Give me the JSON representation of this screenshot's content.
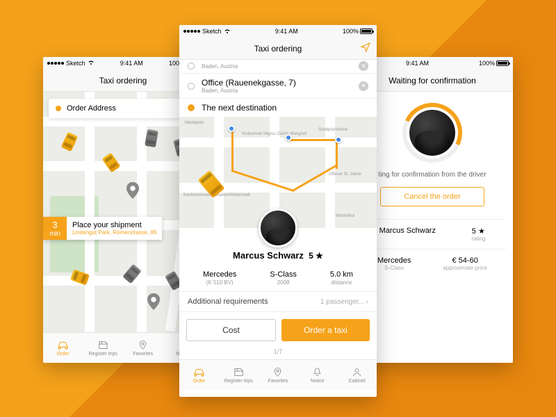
{
  "status": {
    "carrier": "Sketch",
    "time": "9:41 AM",
    "battery": "100%"
  },
  "left": {
    "title": "Taxi ordering",
    "address_label": "Order Address",
    "ship": {
      "min_n": "3",
      "min_u": "min",
      "title": "Place your shipment",
      "addr": "Lindengut Park, Römerstrasse, 86"
    },
    "tabs": [
      "Order",
      "Register trips",
      "Favorites",
      "Notice"
    ]
  },
  "center": {
    "title": "Taxi ordering",
    "addr1": {
      "title": "",
      "sub": "Baden, Austria"
    },
    "addr2": {
      "title": "Office (Rauenekgasse, 7)",
      "sub": "Baden, Austria"
    },
    "next": "The next destination",
    "driver": {
      "name": "Marcus Schwarz",
      "rating": "5"
    },
    "details": {
      "car": "Mercedes",
      "plate": "(K 510 BV)",
      "model": "S-Class",
      "year": "2008",
      "dist": "5.0 km",
      "dist_l": "distance"
    },
    "req": {
      "label": "Additional requirements",
      "value": "1 passenger..."
    },
    "cost_btn": "Cost",
    "order_btn": "Order a taxi",
    "pager": "1/7",
    "tabs": [
      "Order",
      "Register trips",
      "Favorites",
      "Notice",
      "Cabinet"
    ],
    "pois": [
      "Marktplatz",
      "Klubschule Migros Zürich Wenghof",
      "Kantonsmuseum Baden/Winterstadt",
      "Stadtpfarrkirche",
      "Offener St. Jakob",
      "Winterthur"
    ]
  },
  "right": {
    "title": "Waiting for confirmation",
    "msg": "ting for confirmation from the driver",
    "cancel": "Cancel the order",
    "row1": {
      "name": "Marcus Schwarz",
      "rating": "5",
      "rating_l": "rating"
    },
    "row2": {
      "car": "Mercedes",
      "carclass": "S-Class",
      "price": "€ 54-60",
      "price_l": "approximate price"
    }
  }
}
